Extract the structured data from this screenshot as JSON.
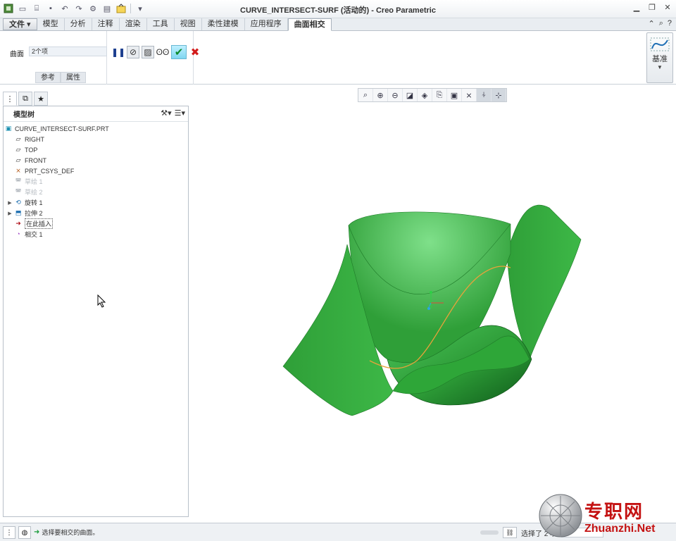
{
  "window": {
    "title": "CURVE_INTERSECT-SURF (活动的) - Creo Parametric"
  },
  "ribbon_tabs": [
    {
      "label": "文件"
    },
    {
      "label": "模型"
    },
    {
      "label": "分析"
    },
    {
      "label": "注释"
    },
    {
      "label": "渲染"
    },
    {
      "label": "工具"
    },
    {
      "label": "视图"
    },
    {
      "label": "柔性建模"
    },
    {
      "label": "应用程序"
    },
    {
      "label": "曲面相交"
    }
  ],
  "ribbon": {
    "surface_label": "曲面",
    "surface_value": "2个项",
    "subtabs": [
      "参考",
      "属性"
    ],
    "datum_label": "基准"
  },
  "model_tree": {
    "header": "模型树",
    "items": [
      {
        "label": "CURVE_INTERSECT-SURF.PRT",
        "icon": "part-icon"
      },
      {
        "label": "RIGHT",
        "icon": "datum-plane-icon"
      },
      {
        "label": "TOP",
        "icon": "datum-plane-icon"
      },
      {
        "label": "FRONT",
        "icon": "datum-plane-icon"
      },
      {
        "label": "PRT_CSYS_DEF",
        "icon": "csys-icon"
      },
      {
        "label": "草绘 1",
        "icon": "sketch-icon"
      },
      {
        "label": "草绘 2",
        "icon": "sketch-icon"
      },
      {
        "label": "旋转 1",
        "icon": "revolve-icon"
      },
      {
        "label": "拉伸 2",
        "icon": "extrude-icon"
      },
      {
        "label": "在此插入",
        "icon": "insert-here-icon"
      },
      {
        "label": "相交 1",
        "icon": "intersect-icon"
      }
    ]
  },
  "status": {
    "message": "选择要相交的曲面。",
    "selection": "选择了 2 项"
  },
  "watermark": {
    "cn": "专职网",
    "en": "Zhuanzhi.Net"
  },
  "colors": {
    "surface_green": "#2e9e3a",
    "ok_green": "#0b8a2a",
    "cancel_red": "#d21b1b",
    "watermark_red": "#c41212"
  }
}
